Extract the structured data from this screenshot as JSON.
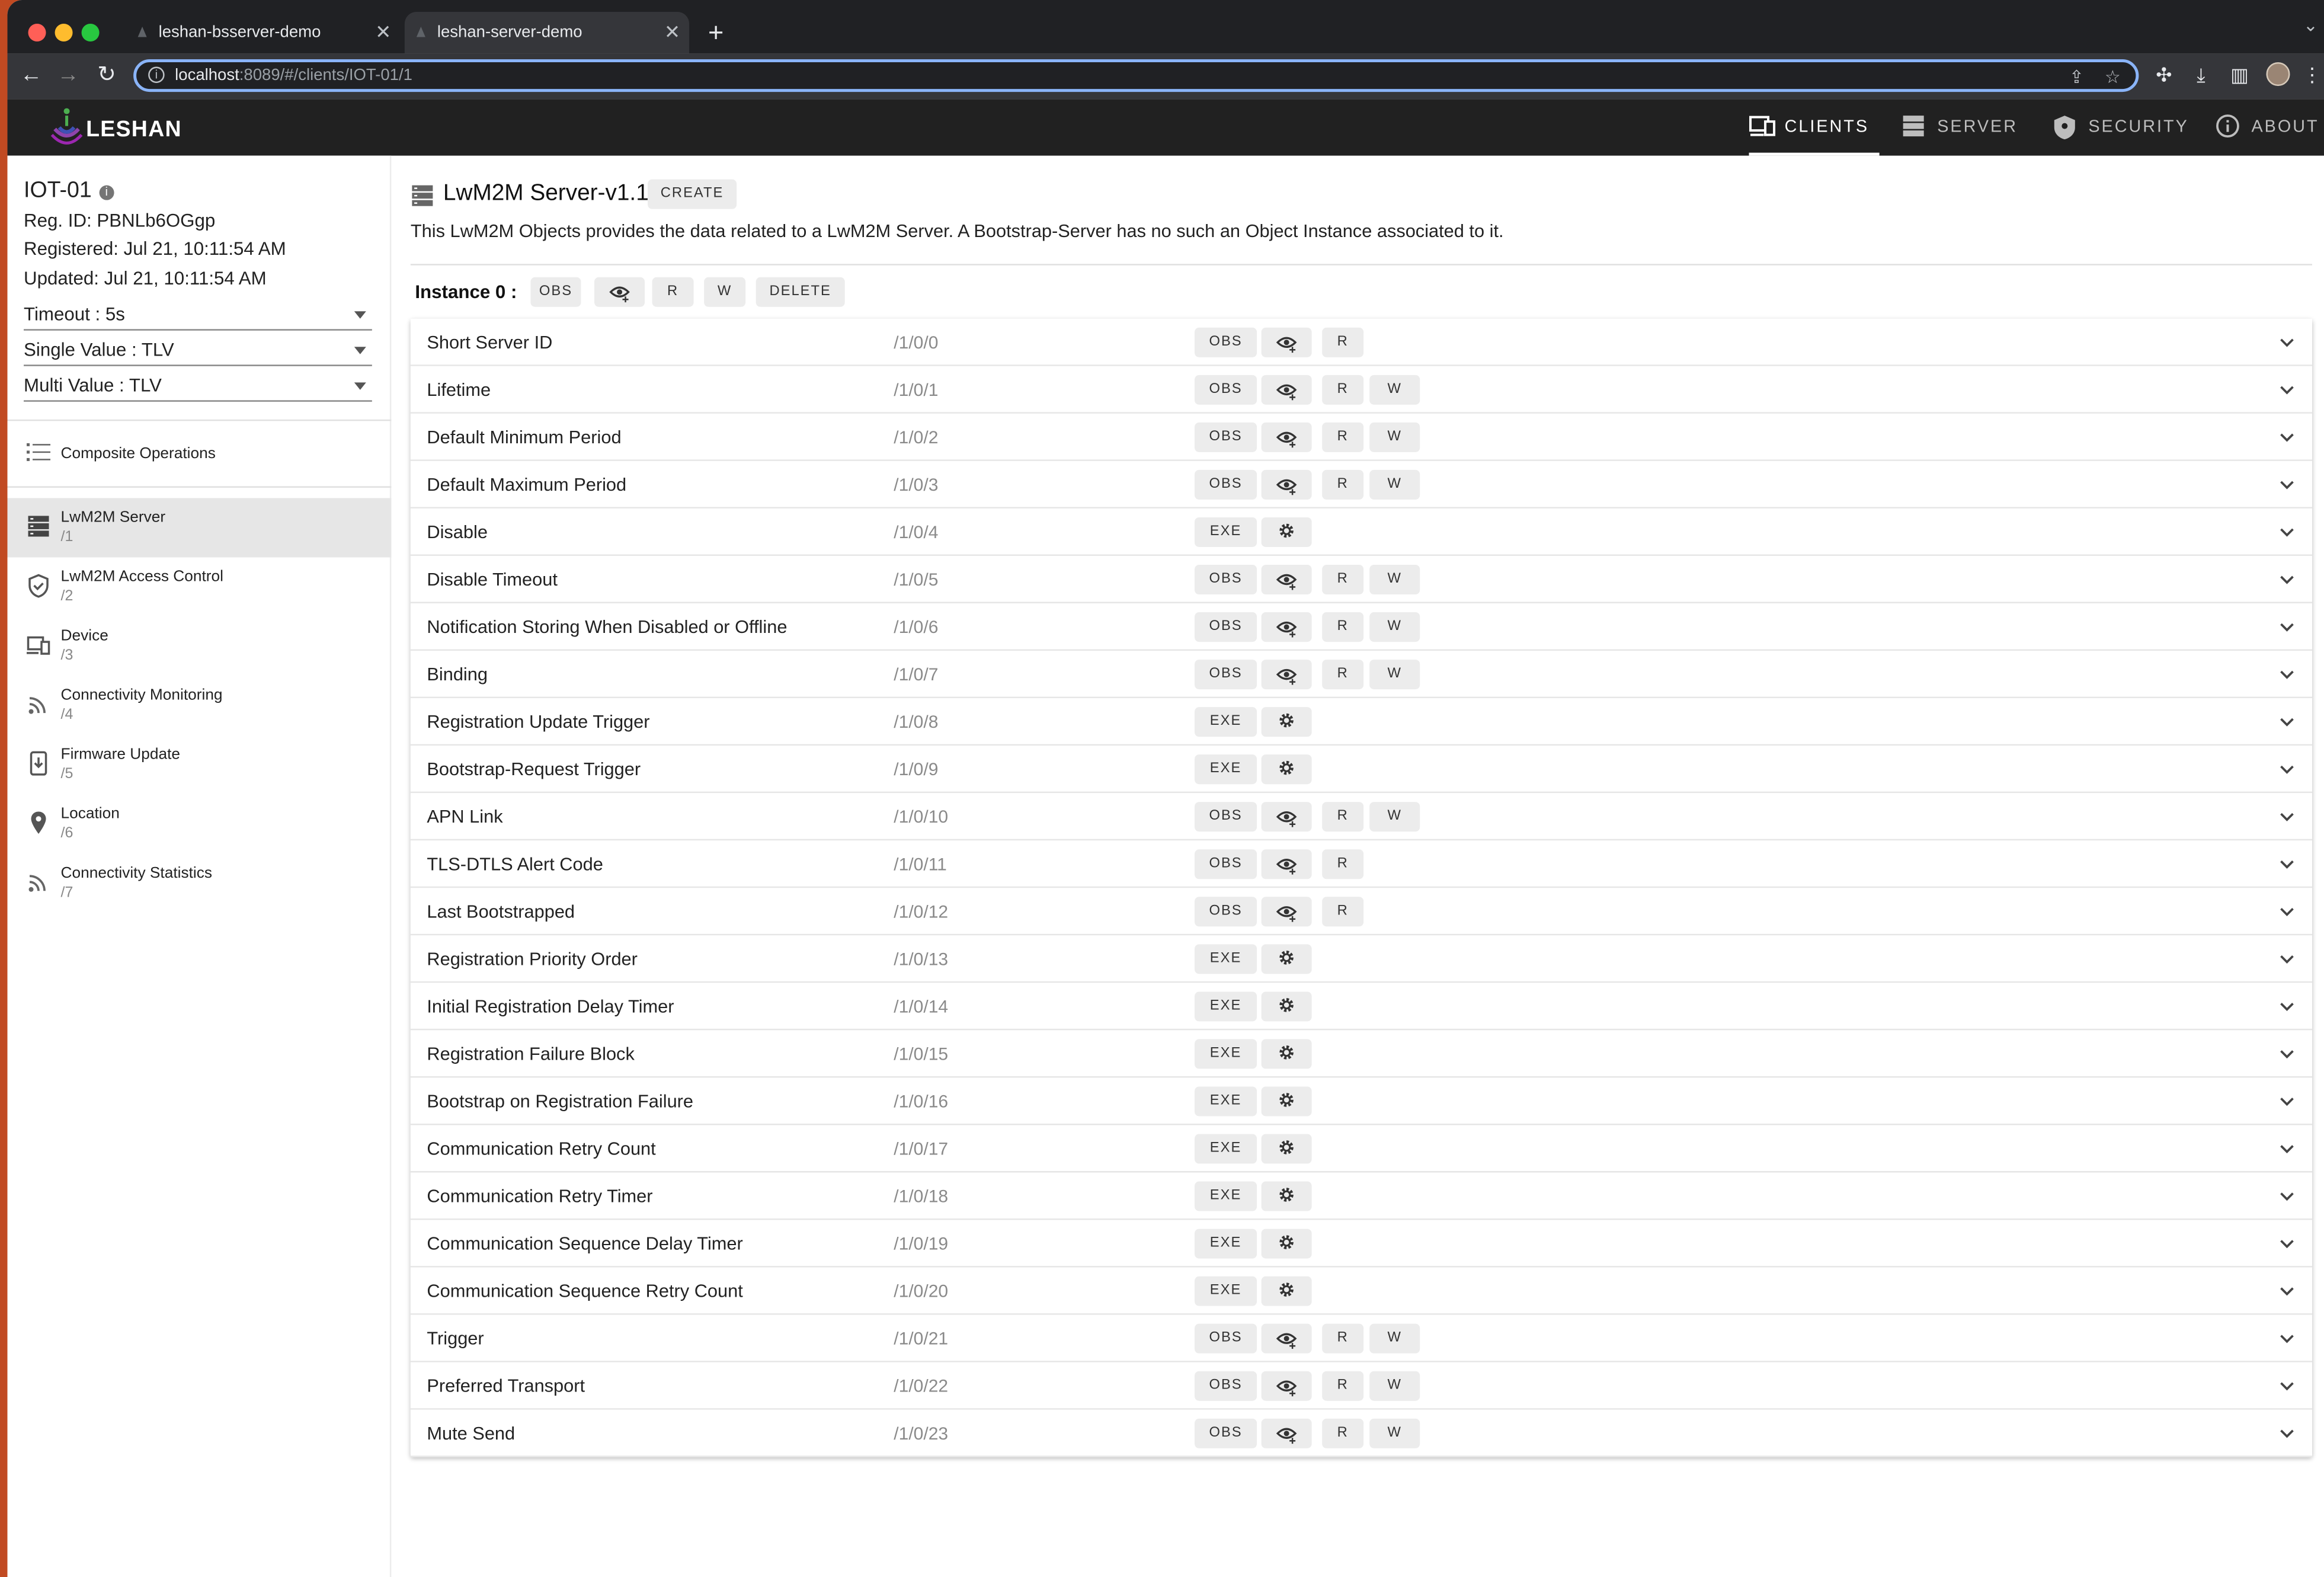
{
  "browser": {
    "tabs": [
      {
        "title": "leshan-bsserver-demo",
        "active": false
      },
      {
        "title": "leshan-server-demo",
        "active": true
      }
    ],
    "url_host": "localhost",
    "url_rest": ":8089/#/clients/IOT-01/1"
  },
  "app": {
    "logo_text": "LESHAN",
    "nav": [
      {
        "label": "CLIENTS",
        "active": true,
        "icon": "clients-icon"
      },
      {
        "label": "SERVER",
        "active": false,
        "icon": "server-icon"
      },
      {
        "label": "SECURITY",
        "active": false,
        "icon": "security-icon"
      },
      {
        "label": "ABOUT",
        "active": false,
        "icon": "about-icon"
      }
    ]
  },
  "client": {
    "name": "IOT-01",
    "reg_id": "Reg. ID: PBNLb6OGgp",
    "registered": "Registered: Jul 21, 10:11:54 AM",
    "updated": "Updated: Jul 21, 10:11:54 AM"
  },
  "settings": {
    "timeout": "Timeout : 5s",
    "single_value": "Single Value : TLV",
    "multi_value": "Multi Value : TLV"
  },
  "sidebar": {
    "composite": "Composite Operations",
    "objects": [
      {
        "label": "LwM2M Server",
        "path": "/1",
        "icon": "server-icon",
        "active": true
      },
      {
        "label": "LwM2M Access Control",
        "path": "/2",
        "icon": "shield-icon",
        "active": false
      },
      {
        "label": "Device",
        "path": "/3",
        "icon": "devices-icon",
        "active": false
      },
      {
        "label": "Connectivity Monitoring",
        "path": "/4",
        "icon": "rss-feed-icon",
        "active": false
      },
      {
        "label": "Firmware Update",
        "path": "/5",
        "icon": "system-update-icon",
        "active": false
      },
      {
        "label": "Location",
        "path": "/6",
        "icon": "location-pin-icon",
        "active": false
      },
      {
        "label": "Connectivity Statistics",
        "path": "/7",
        "icon": "rss-feed-icon",
        "active": false
      }
    ]
  },
  "object": {
    "title": "LwM2M Server-v1.1",
    "create_label": "CREATE",
    "description": "This LwM2M Objects provides the data related to a LwM2M Server. A Bootstrap-Server has no such an Object Instance associated to it.",
    "instance_label": "Instance 0 :",
    "instance_buttons": {
      "obs": "OBS",
      "r": "R",
      "w": "W",
      "delete": "DELETE"
    },
    "btn_labels": {
      "obs": "OBS",
      "exe": "EXE",
      "r": "R",
      "w": "W"
    },
    "resources": [
      {
        "name": "Short Server ID",
        "path": "/1/0/0",
        "kind": "R"
      },
      {
        "name": "Lifetime",
        "path": "/1/0/1",
        "kind": "RW"
      },
      {
        "name": "Default Minimum Period",
        "path": "/1/0/2",
        "kind": "RW"
      },
      {
        "name": "Default Maximum Period",
        "path": "/1/0/3",
        "kind": "RW"
      },
      {
        "name": "Disable",
        "path": "/1/0/4",
        "kind": "E"
      },
      {
        "name": "Disable Timeout",
        "path": "/1/0/5",
        "kind": "RW"
      },
      {
        "name": "Notification Storing When Disabled or Offline",
        "path": "/1/0/6",
        "kind": "RW"
      },
      {
        "name": "Binding",
        "path": "/1/0/7",
        "kind": "RW"
      },
      {
        "name": "Registration Update Trigger",
        "path": "/1/0/8",
        "kind": "E"
      },
      {
        "name": "Bootstrap-Request Trigger",
        "path": "/1/0/9",
        "kind": "E"
      },
      {
        "name": "APN Link",
        "path": "/1/0/10",
        "kind": "RW"
      },
      {
        "name": "TLS-DTLS Alert Code",
        "path": "/1/0/11",
        "kind": "R"
      },
      {
        "name": "Last Bootstrapped",
        "path": "/1/0/12",
        "kind": "R"
      },
      {
        "name": "Registration Priority Order",
        "path": "/1/0/13",
        "kind": "E"
      },
      {
        "name": "Initial Registration Delay Timer",
        "path": "/1/0/14",
        "kind": "E"
      },
      {
        "name": "Registration Failure Block",
        "path": "/1/0/15",
        "kind": "E"
      },
      {
        "name": "Bootstrap on Registration Failure",
        "path": "/1/0/16",
        "kind": "E"
      },
      {
        "name": "Communication Retry Count",
        "path": "/1/0/17",
        "kind": "E"
      },
      {
        "name": "Communication Retry Timer",
        "path": "/1/0/18",
        "kind": "E"
      },
      {
        "name": "Communication Sequence Delay Timer",
        "path": "/1/0/19",
        "kind": "E"
      },
      {
        "name": "Communication Sequence Retry Count",
        "path": "/1/0/20",
        "kind": "E"
      },
      {
        "name": "Trigger",
        "path": "/1/0/21",
        "kind": "RW"
      },
      {
        "name": "Preferred Transport",
        "path": "/1/0/22",
        "kind": "RW"
      },
      {
        "name": "Mute Send",
        "path": "/1/0/23",
        "kind": "RW"
      }
    ]
  },
  "colors": {
    "accent_blue": "#8ab4f8",
    "appbar": "#212121",
    "active_item": "#e6e6e6"
  }
}
